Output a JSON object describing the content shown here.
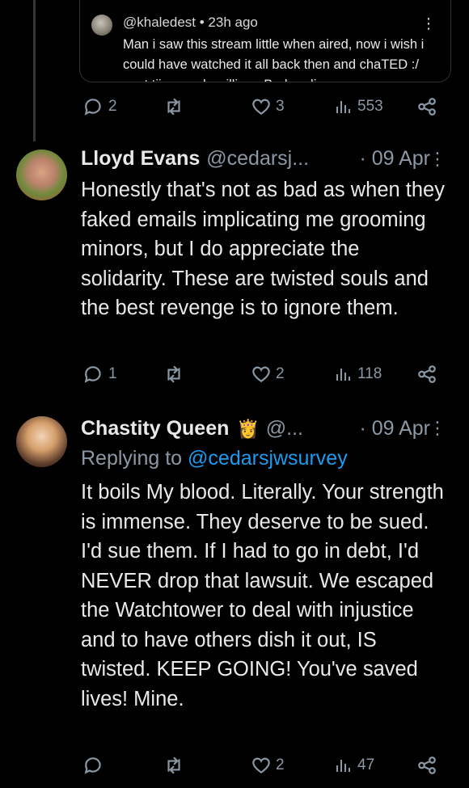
{
  "quoted_comment": {
    "handle": "@khaledest",
    "time": "23h ago",
    "header": "@khaledest • 23h ago",
    "text": "Man i saw this stream little when aired, now i wish i could have  watched it all back then and chaTED :/ next tiime gods willing . Bad audio",
    "menu_icon": "vertical-ellipsis-icon"
  },
  "tweets": [
    {
      "name": "Lloyd Evans",
      "handle": "@cedarsj...",
      "date": "· 09 Apr",
      "replying_to_label": "",
      "replying_to_handle": "",
      "body": "Honestly that's not as bad as when they faked emails implicating me grooming minors, but I do appreciate the solidarity. These are twisted souls and the best revenge is to ignore them.",
      "reply_count": "1",
      "retweet_count": "",
      "like_count": "2",
      "view_count": "118"
    },
    {
      "name": "Chastity Queen",
      "handle": "@...",
      "badge": "👸",
      "date": "· 09 Apr",
      "replying_to_label": "Replying to",
      "replying_to_handle": "@cedarsjwsurvey",
      "body": "It boils My blood. Literally. Your strength is immense. They deserve to be sued. I'd sue them. If I had to go in debt, I'd NEVER drop that lawsuit. We escaped the Watchtower to deal with injustice and to have others dish it out, IS twisted. KEEP GOING! You've saved lives! Mine.",
      "reply_count": "",
      "retweet_count": "",
      "like_count": "2",
      "view_count": "47"
    }
  ],
  "top_actions": {
    "reply_count": "2",
    "retweet_count": "",
    "like_count": "3",
    "view_count": "553"
  },
  "icons": {
    "reply": "reply-icon",
    "retweet": "retweet-icon",
    "like": "like-icon",
    "views": "views-icon",
    "share": "share-icon",
    "menu": "more-icon"
  },
  "colors": {
    "background": "#000000",
    "text": "#e7e9ea",
    "muted": "#8b98a5",
    "link": "#1d9bf0",
    "divider": "#2f3336"
  }
}
